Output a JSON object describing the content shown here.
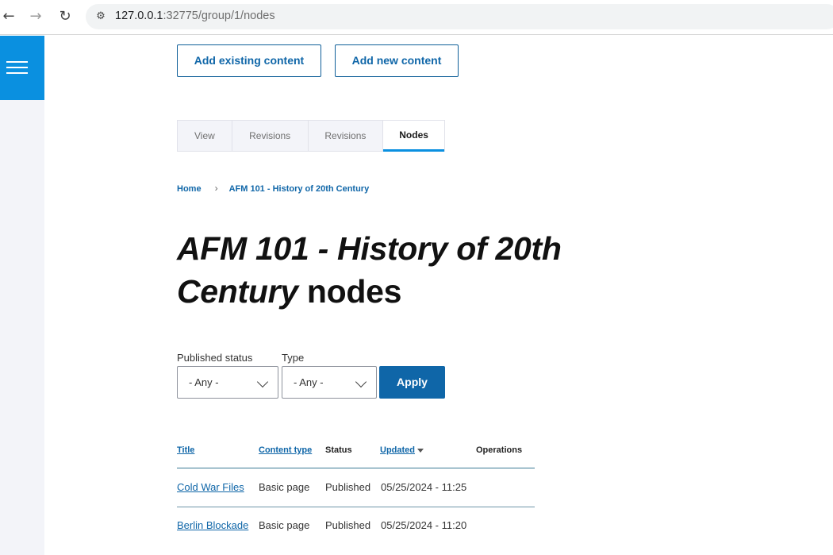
{
  "browser": {
    "url_host": "127.0.0.1",
    "url_path": ":32775/group/1/nodes"
  },
  "actions": {
    "add_existing": "Add existing content",
    "add_new": "Add new content"
  },
  "tabs": [
    {
      "label": "View"
    },
    {
      "label": "Revisions"
    },
    {
      "label": "Revisions"
    },
    {
      "label": "Nodes"
    }
  ],
  "breadcrumb": {
    "home": "Home",
    "current": "AFM 101 - History of 20th Century"
  },
  "page": {
    "title_em": "AFM 101 - History of 20th Century",
    "title_rest": " nodes"
  },
  "filters": {
    "status_label": "Published status",
    "status_value": "- Any -",
    "type_label": "Type",
    "type_value": "- Any -",
    "apply_label": "Apply"
  },
  "table": {
    "headers": {
      "title": "Title",
      "content_type": "Content type",
      "status": "Status",
      "updated": "Updated",
      "operations": "Operations"
    },
    "rows": [
      {
        "title": "Cold War Files",
        "content_type": "Basic page",
        "status": "Published",
        "updated": "05/25/2024 - 11:25"
      },
      {
        "title": "Berlin Blockade",
        "content_type": "Basic page",
        "status": "Published",
        "updated": "05/25/2024 - 11:20"
      }
    ]
  }
}
